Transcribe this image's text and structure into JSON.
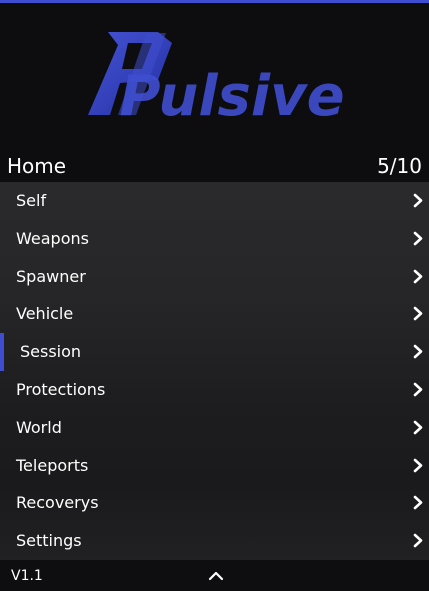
{
  "header": {
    "logo_text": "Pulsive",
    "accent_color": "#3f4ed0"
  },
  "subheader": {
    "title": "Home",
    "count": "5/10"
  },
  "options": [
    {
      "label": "Self",
      "icon": "chevron-right-icon"
    },
    {
      "label": "Weapons",
      "icon": "chevron-right-icon"
    },
    {
      "label": "Spawner",
      "icon": "chevron-right-icon"
    },
    {
      "label": "Vehicle",
      "icon": "chevron-right-icon"
    },
    {
      "label": "Session",
      "icon": "chevron-right-icon",
      "selected": true
    },
    {
      "label": "Protections",
      "icon": "chevron-right-icon"
    },
    {
      "label": "World",
      "icon": "chevron-right-icon"
    },
    {
      "label": "Teleports",
      "icon": "chevron-right-icon"
    },
    {
      "label": "Recoverys",
      "icon": "chevron-right-icon"
    },
    {
      "label": "Settings",
      "icon": "chevron-right-icon"
    }
  ],
  "footer": {
    "version": "V1.1",
    "icon": "chevron-up-icon"
  }
}
